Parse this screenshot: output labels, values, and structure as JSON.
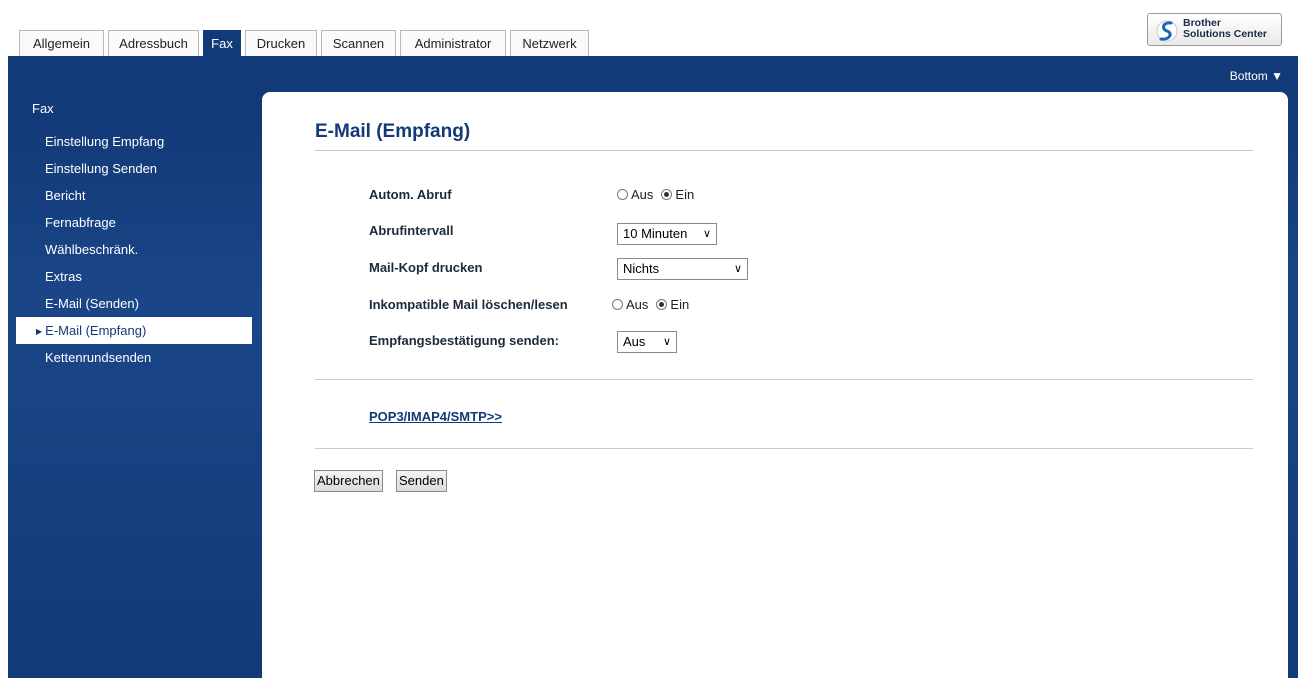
{
  "tabs": [
    {
      "label": "Allgemein",
      "active": false
    },
    {
      "label": "Adressbuch",
      "active": false
    },
    {
      "label": "Fax",
      "active": true
    },
    {
      "label": "Drucken",
      "active": false
    },
    {
      "label": "Scannen",
      "active": false
    },
    {
      "label": "Administrator",
      "active": false
    },
    {
      "label": "Netzwerk",
      "active": false
    }
  ],
  "solutions_center": {
    "line1": "Brother",
    "line2": "Solutions Center"
  },
  "bottom_link": "Bottom ▼",
  "sidebar": {
    "heading": "Fax",
    "items": [
      {
        "label": "Einstellung Empfang",
        "active": false
      },
      {
        "label": "Einstellung Senden",
        "active": false
      },
      {
        "label": "Bericht",
        "active": false
      },
      {
        "label": "Fernabfrage",
        "active": false
      },
      {
        "label": "Wählbeschränk.",
        "active": false
      },
      {
        "label": "Extras",
        "active": false
      },
      {
        "label": "E-Mail (Senden)",
        "active": false
      },
      {
        "label": "E-Mail (Empfang)",
        "active": true
      },
      {
        "label": "Kettenrundsenden",
        "active": false
      }
    ]
  },
  "page": {
    "title": "E-Mail (Empfang)",
    "fields": {
      "auto_abruf": {
        "label": "Autom. Abruf",
        "options": [
          "Aus",
          "Ein"
        ],
        "selected": "Ein"
      },
      "abrufintervall": {
        "label": "Abrufintervall",
        "value": "10 Minuten"
      },
      "mail_kopf": {
        "label": "Mail-Kopf drucken",
        "value": "Nichts"
      },
      "inkompatible": {
        "label": "Inkompatible Mail löschen/lesen",
        "options": [
          "Aus",
          "Ein"
        ],
        "selected": "Ein"
      },
      "bestaetigung": {
        "label": "Empfangsbestätigung senden:",
        "value": "Aus"
      }
    },
    "link": "POP3/IMAP4/SMTP>>",
    "buttons": {
      "cancel": "Abbrechen",
      "submit": "Senden"
    }
  }
}
